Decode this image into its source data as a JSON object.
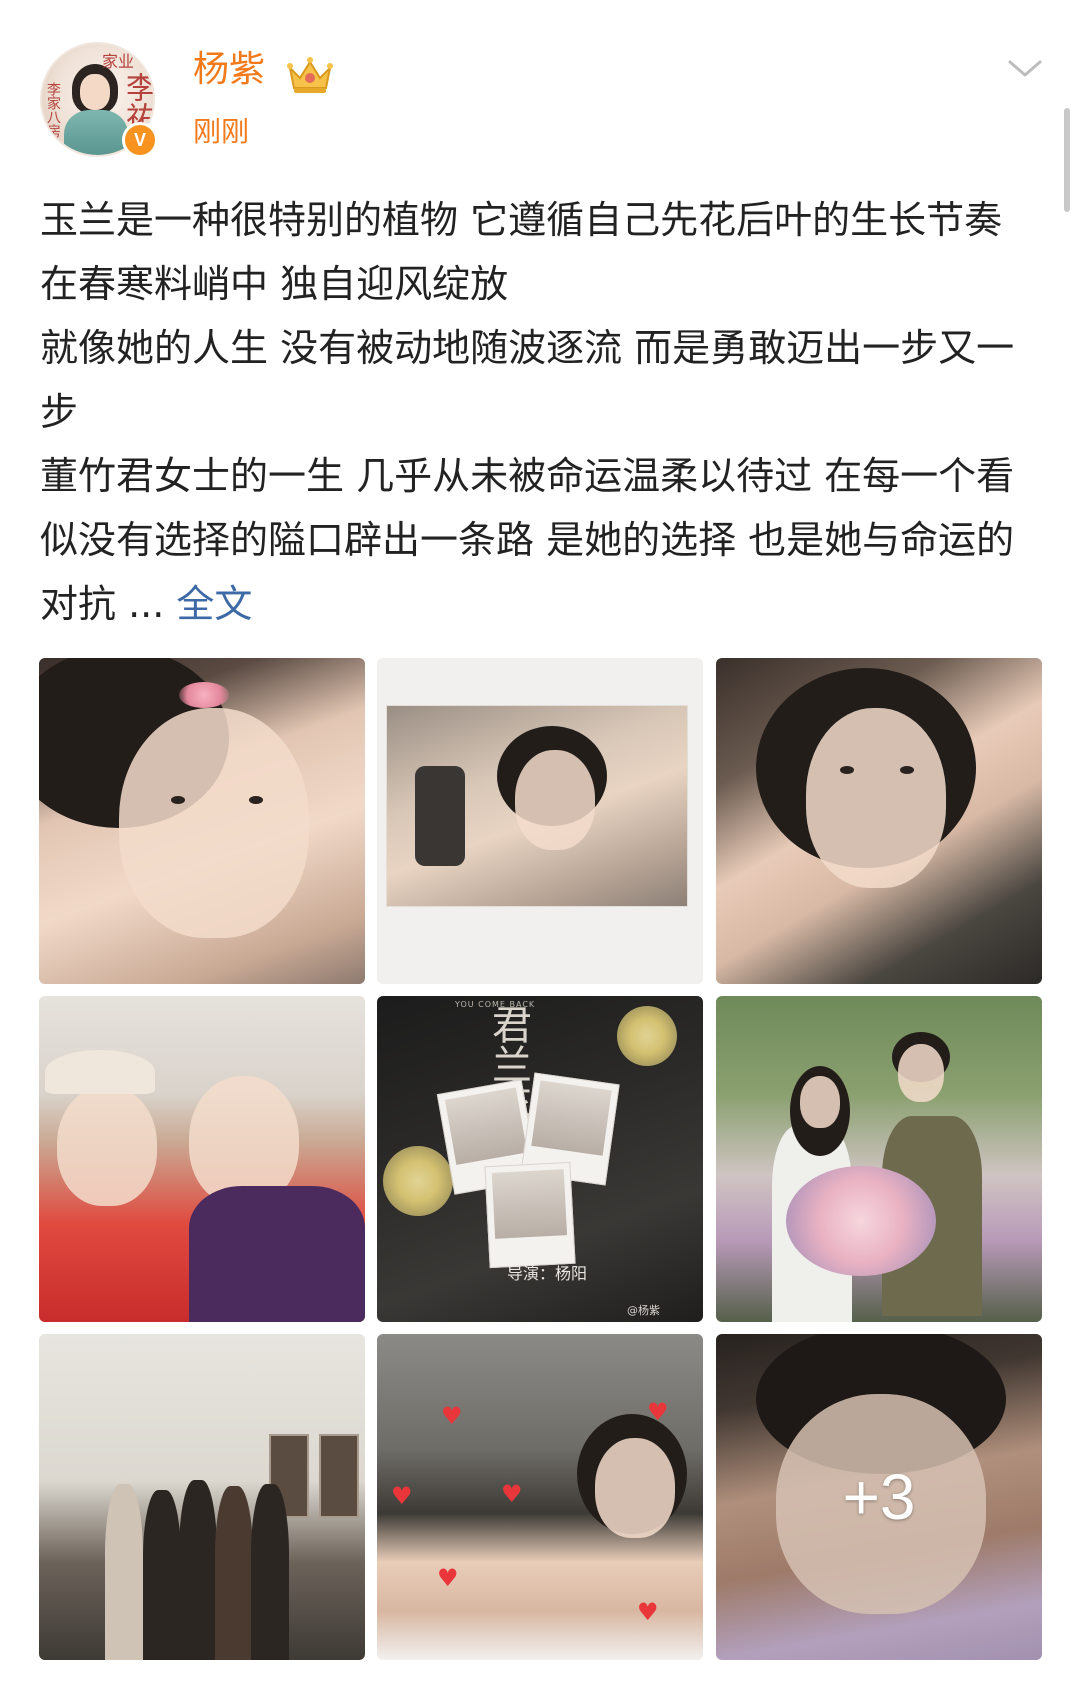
{
  "post": {
    "author": {
      "name": "杨紫",
      "avatar_text": {
        "line1": "家业",
        "line2": "李祐",
        "line3": "李家八房"
      },
      "verified_mark": "V"
    },
    "timestamp": "刚刚",
    "text": {
      "paragraph1": "玉兰是一种很特别的植物 它遵循自己先花后叶的生长节奏 在春寒料峭中 独自迎风绽放",
      "paragraph2": "就像她的人生 没有被动地随波逐流 而是勇敢迈出一步又一步",
      "paragraph3": "董竹君女士的一生 几乎从未被命运温柔以待过 在每一个看似没有选择的隘口辟出一条路 是她的选择 也是她与命运的对抗 ...",
      "full_text_link": "全文"
    },
    "images": {
      "poster": {
        "subtitle": "YOU COME BACK",
        "title": "君兰花开",
        "director_credit": "导演：杨阳",
        "watermark": "@杨紫"
      },
      "more_count": "+3"
    }
  },
  "colors": {
    "brand_orange": "#f27a1a",
    "link_blue": "#3d6aa6",
    "verified_orange": "#f7931e",
    "text_dark": "#222222"
  },
  "icons": {
    "membership": "crown-icon",
    "menu": "chevron-down-icon",
    "verified": "verified-badge-icon"
  }
}
